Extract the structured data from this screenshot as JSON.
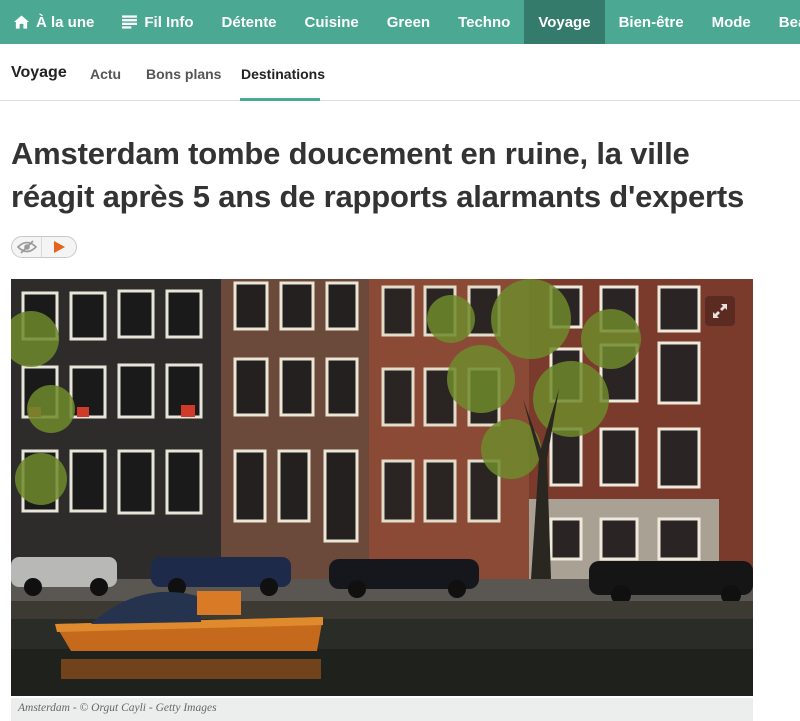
{
  "nav": {
    "items": [
      {
        "label": "À la une",
        "icon": "home-icon"
      },
      {
        "label": "Fil Info",
        "icon": "list-icon"
      },
      {
        "label": "Détente"
      },
      {
        "label": "Cuisine"
      },
      {
        "label": "Green"
      },
      {
        "label": "Techno"
      },
      {
        "label": "Voyage",
        "active": true
      },
      {
        "label": "Bien-être"
      },
      {
        "label": "Mode"
      },
      {
        "label": "Beauté"
      }
    ],
    "color": "#4aa893",
    "active_color": "#357b6b"
  },
  "subnav": {
    "section_title": "Voyage",
    "items": [
      {
        "label": "Actu"
      },
      {
        "label": "Bons plans"
      },
      {
        "label": "Destinations",
        "active": true
      }
    ]
  },
  "article": {
    "headline": "Amsterdam tombe doucement en ruine, la ville réagit après 5 ans de rapports alarmants d'experts",
    "player_icons": [
      "eye-slash-icon",
      "play-icon"
    ],
    "image_caption": "Amsterdam - © Orgut Cayli - Getty Images",
    "expand_icon": "expand-icon"
  }
}
